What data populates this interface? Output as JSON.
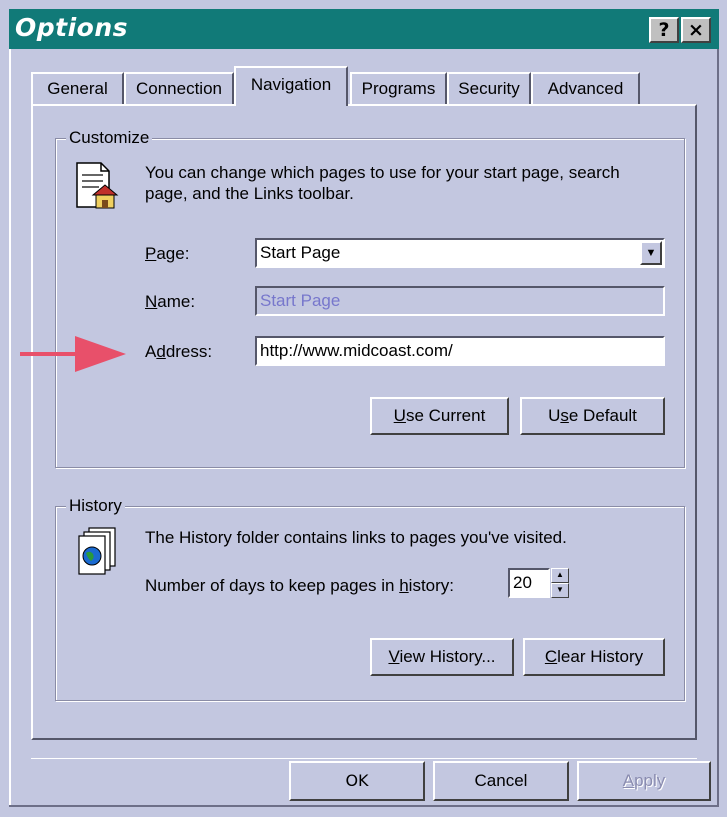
{
  "window": {
    "title": "Options",
    "help_button": "?",
    "close_button": "×"
  },
  "tabs": [
    {
      "label": "General"
    },
    {
      "label": "Connection"
    },
    {
      "label": "Navigation",
      "active": true
    },
    {
      "label": "Programs"
    },
    {
      "label": "Security"
    },
    {
      "label": "Advanced"
    }
  ],
  "customize": {
    "legend": "Customize",
    "description": "You can change which pages to use for your start page, search page, and the Links toolbar.",
    "page_label": {
      "key": "P",
      "rest": "age:"
    },
    "page_value": "Start Page",
    "name_label": {
      "key": "N",
      "rest": "ame:"
    },
    "name_value": "Start Page",
    "address_label": {
      "pre": "A",
      "key": "d",
      "rest": "dress:"
    },
    "address_value": "http://www.midcoast.com/",
    "use_current": {
      "key": "U",
      "rest": "se Current"
    },
    "use_default": {
      "pre": "U",
      "key": "s",
      "rest": "e Default"
    }
  },
  "history": {
    "legend": "History",
    "description": "The History folder contains links to pages you've visited.",
    "days_label": {
      "pre": "Number of days to keep pages in ",
      "key": "h",
      "rest": "istory:"
    },
    "days_value": "20",
    "view_history": {
      "key": "V",
      "rest": "iew History..."
    },
    "clear_history": {
      "key": "C",
      "rest": "lear History"
    }
  },
  "footer": {
    "ok": "OK",
    "cancel": "Cancel",
    "apply": {
      "key": "A",
      "rest": "pply"
    }
  },
  "colors": {
    "titlebar": "#117a78",
    "face": "#c3c7e0",
    "arrow": "#e8506a"
  },
  "icons": {
    "customize": "document-home-icon",
    "history": "history-folder-globe-icon",
    "pointer": "red-arrow-pointer"
  }
}
